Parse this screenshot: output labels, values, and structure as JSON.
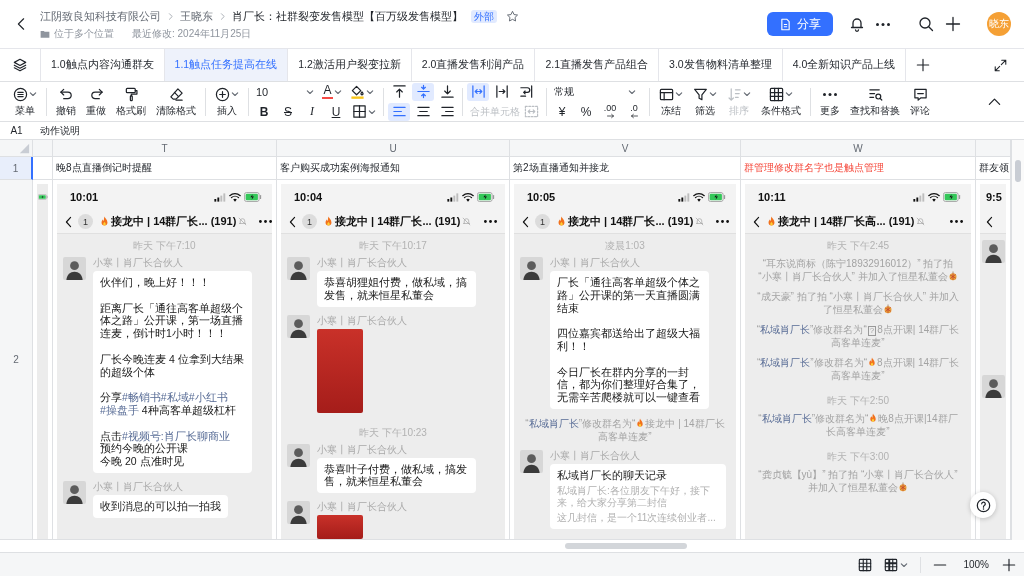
{
  "header": {
    "breadcrumb": [
      "江阴致良知科技有限公司",
      "王晓东",
      "肖厂长：社群裂变发售模型【百万级发售模型】"
    ],
    "badge": "外部",
    "starred": false,
    "location": "位于多个位置",
    "modified": "最近修改: 2024年11月25日",
    "share": "分享",
    "avatar": "晓东"
  },
  "sheet_tabs": [
    {
      "label": "1.0触点内容沟通群友",
      "selected": false
    },
    {
      "label": "1.1触点任务提高在线",
      "selected": true
    },
    {
      "label": "1.2激活用户裂变拉新",
      "selected": false
    },
    {
      "label": "2.0直播发售利润产品",
      "selected": false
    },
    {
      "label": "2.1直播发售产品组合",
      "selected": false
    },
    {
      "label": "3.0发售物料清单整理",
      "selected": false
    },
    {
      "label": "4.0全新知识产品上线",
      "selected": false
    }
  ],
  "toolbar": {
    "sections": [
      {
        "kind": "stack",
        "tools": [
          {
            "kind": "menu",
            "label": "菜单",
            "dropdown": true
          }
        ]
      },
      {
        "kind": "stack",
        "tools": [
          {
            "kind": "undo",
            "label": "撤销"
          },
          {
            "kind": "redo",
            "label": "重做"
          },
          {
            "kind": "painter",
            "label": "格式刷"
          },
          {
            "kind": "eraser",
            "label": "清除格式"
          }
        ]
      },
      {
        "kind": "stack",
        "tools": [
          {
            "kind": "insert",
            "label": "插入",
            "dropdown": true
          }
        ]
      },
      {
        "kind": "grid",
        "rows": [
          [
            {
              "kind": "size",
              "label": "10",
              "dropdown": true
            },
            {
              "kind": "color",
              "label": "A",
              "dropdown": true
            },
            {
              "kind": "fill",
              "dropdown": true
            }
          ],
          [
            {
              "kind": "bold",
              "label": "B"
            },
            {
              "kind": "strike",
              "label": "S"
            },
            {
              "kind": "italic",
              "label": "I"
            },
            {
              "kind": "underline",
              "label": "U"
            },
            {
              "kind": "border",
              "dropdown": true
            }
          ]
        ]
      },
      {
        "kind": "grid",
        "rows": [
          [
            {
              "kind": "top",
              "selected": false
            },
            {
              "kind": "middle",
              "selected": true
            },
            {
              "kind": "bottom",
              "selected": false
            }
          ],
          [
            {
              "kind": "left",
              "selected": true
            },
            {
              "kind": "center",
              "selected": false
            },
            {
              "kind": "right",
              "selected": false
            }
          ]
        ]
      },
      {
        "kind": "grid",
        "rows": [
          [
            {
              "kind": "overflow",
              "selected": true
            },
            {
              "kind": "clip",
              "selected": false
            },
            {
              "kind": "wrap",
              "selected": false
            }
          ],
          [
            {
              "kind": "merge",
              "label": "合并单元格",
              "disabled": true
            }
          ]
        ]
      },
      {
        "kind": "grid",
        "rows": [
          [
            {
              "kind": "format",
              "label": "常规",
              "dropdown": true
            }
          ],
          [
            {
              "kind": "currency",
              "label": "¥"
            },
            {
              "kind": "percent",
              "label": "%"
            },
            {
              "kind": "increase",
              "label": ".00"
            },
            {
              "kind": "decrease",
              "label": ".0"
            }
          ]
        ]
      },
      {
        "kind": "stack",
        "tools": [
          {
            "kind": "freeze",
            "label": "冻结",
            "dropdown": true,
            "disabled": false
          },
          {
            "kind": "filter",
            "label": "筛选",
            "dropdown": true,
            "disabled": false
          },
          {
            "kind": "sort",
            "label": "排序",
            "dropdown": true,
            "disabled": true
          },
          {
            "kind": "conditional",
            "label": "条件格式",
            "dropdown": true,
            "disabled": false
          }
        ]
      },
      {
        "kind": "stack",
        "tools": [
          {
            "kind": "more",
            "label": "更多"
          },
          {
            "kind": "find",
            "label": "查找和替换"
          },
          {
            "kind": "comment",
            "label": "评论"
          }
        ]
      }
    ]
  },
  "formula_bar": {
    "cell": "A1",
    "value": "动作说明"
  },
  "sheet": {
    "columns": [
      {},
      {
        "letter": "T"
      },
      {
        "letter": "U"
      },
      {
        "letter": "V"
      },
      {
        "letter": "W"
      },
      {}
    ],
    "rows": [
      {
        "number": "1",
        "selected": true,
        "cells": [
          {},
          {
            "text": "晚8点直播倒记时提醒",
            "highlighted": false
          },
          {
            "text": "客户购买成功案例海报通知",
            "highlighted": false
          },
          {
            "text": "第2场直播通知并接龙",
            "highlighted": false
          },
          {
            "text": "群管理修改群名字也是触点管理",
            "highlighted": true
          },
          {
            "text": "群友领",
            "highlighted": false
          }
        ]
      },
      {
        "number": "2",
        "selected": false,
        "cells": [
          {
            "kind": "phone_edge"
          },
          {
            "kind": "phone",
            "time": "10:01",
            "badge": "1",
            "title": [
              {
                "kind": "fire"
              },
              "接龙中 | 14群厂长... (191)"
            ],
            "muted": true,
            "messages": [
              {
                "kind": "time",
                "text": "昨天 下午7:10"
              },
              {
                "kind": "text",
                "sender": "小寒丨肖厂长合伙人",
                "paragraphs": [
                  [
                    "伙伴们，晚上好！！！"
                  ],
                  [
                    "距离厂长「通往高客单超级个体之路」公开课，第一场直播连麦，倒计时1小时！！！"
                  ],
                  [
                    "厂长今晚连麦 4 位拿到大结果的超级个体"
                  ],
                  [
                    [
                      "分享",
                      {
                        "kind": "tag",
                        "text": "#畅销书"
                      },
                      {
                        "kind": "tag",
                        "text": "#私域"
                      },
                      {
                        "kind": "tag",
                        "text": "#小红书"
                      },
                      {
                        "kind": "tag",
                        "text": "#操盘手"
                      },
                      " 4种高客单超级杠杆"
                    ]
                  ],
                  [
                    [
                      "点击",
                      {
                        "kind": "tag",
                        "text": "#视频号:肖厂长聊商业"
                      }
                    ],
                    "预约今晚的公开课",
                    "今晚 20 点准时见"
                  ]
                ]
              },
              {
                "kind": "text",
                "sender": "小寒丨肖厂长合伙人",
                "paragraphs": [
                  [
                    "收到消息的可以拍一拍我"
                  ]
                ]
              }
            ]
          },
          {
            "kind": "phone",
            "time": "10:04",
            "badge": "1",
            "title": [
              {
                "kind": "fire"
              },
              "接龙中 | 14群厂长... (191)"
            ],
            "muted": true,
            "messages": [
              {
                "kind": "time",
                "text": "昨天 下午10:17"
              },
              {
                "kind": "text",
                "sender": "小寒丨肖厂长合伙人",
                "paragraphs": [
                  [
                    "恭喜胡狸姐付费，做私域，搞发售，就来恒星私董会"
                  ]
                ]
              },
              {
                "kind": "image",
                "sender": "小寒丨肖厂长合伙人"
              },
              {
                "kind": "time",
                "text": "昨天 下午10:23"
              },
              {
                "kind": "text",
                "sender": "小寒丨肖厂长合伙人",
                "paragraphs": [
                  [
                    "恭喜叶子付费，做私域，搞发售，就来恒星私董会"
                  ]
                ]
              },
              {
                "kind": "image",
                "sender": "小寒丨肖厂长合伙人"
              }
            ]
          },
          {
            "kind": "phone",
            "time": "10:05",
            "badge": "1",
            "title": [
              {
                "kind": "fire"
              },
              "接龙中 | 14群厂长... (191)"
            ],
            "muted": true,
            "messages": [
              {
                "kind": "time",
                "text": "凌晨1:03"
              },
              {
                "kind": "text",
                "sender": "小寒丨肖厂长合伙人",
                "paragraphs": [
                  [
                    "厂长「通往高客单超级个体之路」公开课的第一天直播圆满结束"
                  ],
                  [
                    "四位嘉宾都送给出了超级大福利！！"
                  ],
                  [
                    "今日厂长在群内分享的一封信，都为你们整理好合集了，无需辛苦爬楼就可以一键查看"
                  ]
                ]
              },
              {
                "kind": "system",
                "parts": [
                  "“",
                  {
                    "kind": "name",
                    "text": "私域肖厂长"
                  },
                  "”修改群名为“",
                  {
                    "kind": "fire"
                  },
                  "接龙中 | 14群厂长高客单连麦”"
                ]
              },
              {
                "kind": "card",
                "sender": "小寒丨肖厂长合伙人",
                "title": "私域肖厂长的聊天记录",
                "lines": [
                  "私域肖厂长:各位朋友下午好，接下来，给大家分享第二封信",
                  "这几封信，是一个11次连续创业者..."
                ]
              }
            ]
          },
          {
            "kind": "phone",
            "time": "10:11",
            "title": [
              {
                "kind": "fire"
              },
              "接龙中 | 14群厂长高... (191)"
            ],
            "muted": true,
            "messages": [
              {
                "kind": "time",
                "text": "昨天 下午2:45"
              },
              {
                "kind": "system",
                "parts": [
                  "“耳东说商标（陈宁18932916012）” 拍了拍 “小寒丨肖厂长合伙人” 并加入了恒星私董会",
                  {
                    "kind": "confetti"
                  }
                ]
              },
              {
                "kind": "system",
                "parts": [
                  "“成天豪” 拍了拍 “小寒丨肖厂长合伙人” 并加入了恒星私董会",
                  {
                    "kind": "confetti"
                  }
                ]
              },
              {
                "kind": "system",
                "parts": [
                  "“",
                  {
                    "kind": "name",
                    "text": "私域肖厂长"
                  },
                  "”修改群名为“",
                  {
                    "kind": "missing",
                    "text": "?"
                  },
                  "8点开课| 14群厂长高客单连麦”"
                ]
              },
              {
                "kind": "system",
                "parts": [
                  "“",
                  {
                    "kind": "name",
                    "text": "私域肖厂长"
                  },
                  "”修改群名为“",
                  {
                    "kind": "fire"
                  },
                  "8点开课| 14群厂长高客单连麦”"
                ]
              },
              {
                "kind": "time",
                "text": "昨天 下午2:50"
              },
              {
                "kind": "system",
                "parts": [
                  "“",
                  {
                    "kind": "name",
                    "text": "私域肖厂长"
                  },
                  "”修改群名为“",
                  {
                    "kind": "fire"
                  },
                  "晚8点开课|14群厂长高客单连麦”"
                ]
              },
              {
                "kind": "time",
                "text": "昨天 下午3:00"
              },
              {
                "kind": "system",
                "parts": [
                  "“龚贞毓【yù】” 拍了拍 “小寒丨肖厂长合伙人” 并加入了恒星私董会",
                  {
                    "kind": "confetti"
                  }
                ]
              }
            ]
          },
          {
            "kind": "phone_partial",
            "time": "9:5",
            "messages": [
              {
                "kind": "avatar"
              },
              {
                "kind": "avatar"
              }
            ]
          }
        ]
      }
    ]
  },
  "status_bar": {
    "zoom": "100%"
  }
}
